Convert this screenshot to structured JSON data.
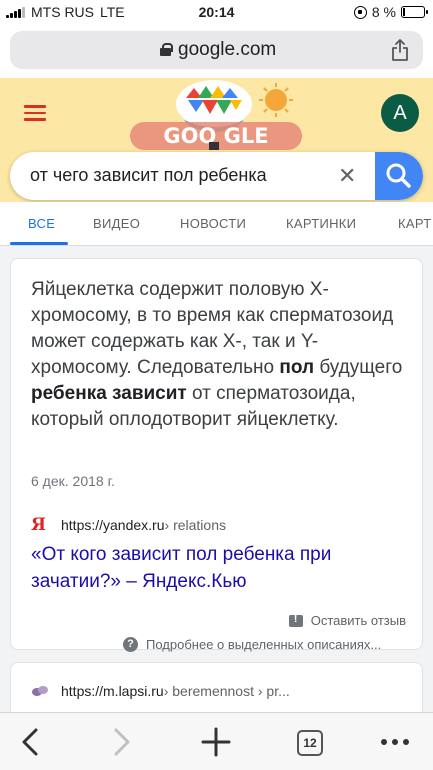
{
  "status": {
    "carrier": "MTS RUS",
    "network": "LTE",
    "time": "20:14",
    "battery": "8 %",
    "battery_level": 0.08
  },
  "browser": {
    "url": "google.com",
    "tab_count": "12"
  },
  "google": {
    "doodle_text": "GOO GLE",
    "avatar_letter": "A"
  },
  "search": {
    "query": "от чего зависит пол ребенка",
    "clear": "✕"
  },
  "tabs": [
    {
      "label": "ВСЕ"
    },
    {
      "label": "ВИДЕО"
    },
    {
      "label": "НОВОСТИ"
    },
    {
      "label": "КАРТИНКИ"
    },
    {
      "label": "КАРТ"
    }
  ],
  "result1": {
    "snippet_a": "Яйцеклетка содержит половую X-хромосому, в то время как сперматозоид может содержать как X-, так и Y-хромосому. Следовательно ",
    "bold1": "пол",
    "snippet_b": " будущего ",
    "bold2": "ребенка зависит",
    "snippet_c": " от сперматозоида, который оплодотворит яйцеклетку.",
    "date": "6 дек. 2018 г.",
    "favicon_letter": "Я",
    "source_url": "https://yandex.ru",
    "source_crumb": " › relations",
    "title": "«От кого зависит пол ребенка при зачатии?» – Яндекс.Кью",
    "feedback": "Оставить отзыв",
    "more_about": "Подробнее о выделенных описаниях..."
  },
  "result2": {
    "source_url": "https://m.lapsi.ru",
    "source_crumb": " › beremennost › pr..."
  }
}
